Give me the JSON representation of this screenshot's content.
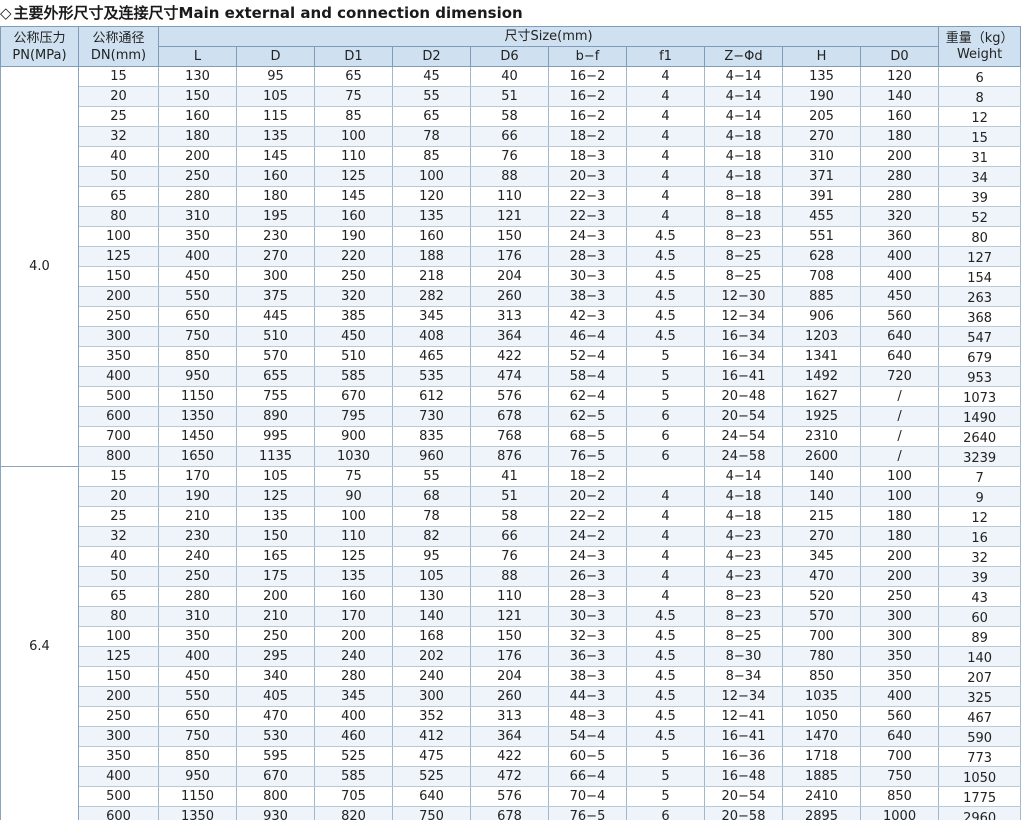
{
  "heading": {
    "diamond": "◇",
    "text": "主要外形尺寸及连接尺寸Main external and connection dimension"
  },
  "header": {
    "pn_cn": "公称压力",
    "pn_en": "PN(MPa)",
    "dn_cn": "公称通径",
    "dn_en": "DN(mm)",
    "size": "尺寸Size(mm)",
    "weight_cn": "重量（kg）",
    "weight_en": "Weight",
    "cols": [
      "L",
      "D",
      "D1",
      "D2",
      "D6",
      "b−f",
      "f1",
      "Z−Φd",
      "H",
      "D0"
    ]
  },
  "groups": [
    {
      "pn": "4.0",
      "rows": [
        [
          "15",
          "130",
          "95",
          "65",
          "45",
          "40",
          "16−2",
          "4",
          "4−14",
          "135",
          "120",
          "6"
        ],
        [
          "20",
          "150",
          "105",
          "75",
          "55",
          "51",
          "16−2",
          "4",
          "4−14",
          "190",
          "140",
          "8"
        ],
        [
          "25",
          "160",
          "115",
          "85",
          "65",
          "58",
          "16−2",
          "4",
          "4−14",
          "205",
          "160",
          "12"
        ],
        [
          "32",
          "180",
          "135",
          "100",
          "78",
          "66",
          "18−2",
          "4",
          "4−18",
          "270",
          "180",
          "15"
        ],
        [
          "40",
          "200",
          "145",
          "110",
          "85",
          "76",
          "18−3",
          "4",
          "4−18",
          "310",
          "200",
          "31"
        ],
        [
          "50",
          "250",
          "160",
          "125",
          "100",
          "88",
          "20−3",
          "4",
          "4−18",
          "371",
          "280",
          "34"
        ],
        [
          "65",
          "280",
          "180",
          "145",
          "120",
          "110",
          "22−3",
          "4",
          "8−18",
          "391",
          "280",
          "39"
        ],
        [
          "80",
          "310",
          "195",
          "160",
          "135",
          "121",
          "22−3",
          "4",
          "8−18",
          "455",
          "320",
          "52"
        ],
        [
          "100",
          "350",
          "230",
          "190",
          "160",
          "150",
          "24−3",
          "4.5",
          "8−23",
          "551",
          "360",
          "80"
        ],
        [
          "125",
          "400",
          "270",
          "220",
          "188",
          "176",
          "28−3",
          "4.5",
          "8−25",
          "628",
          "400",
          "127"
        ],
        [
          "150",
          "450",
          "300",
          "250",
          "218",
          "204",
          "30−3",
          "4.5",
          "8−25",
          "708",
          "400",
          "154"
        ],
        [
          "200",
          "550",
          "375",
          "320",
          "282",
          "260",
          "38−3",
          "4.5",
          "12−30",
          "885",
          "450",
          "263"
        ],
        [
          "250",
          "650",
          "445",
          "385",
          "345",
          "313",
          "42−3",
          "4.5",
          "12−34",
          "906",
          "560",
          "368"
        ],
        [
          "300",
          "750",
          "510",
          "450",
          "408",
          "364",
          "46−4",
          "4.5",
          "16−34",
          "1203",
          "640",
          "547"
        ],
        [
          "350",
          "850",
          "570",
          "510",
          "465",
          "422",
          "52−4",
          "5",
          "16−34",
          "1341",
          "640",
          "679"
        ],
        [
          "400",
          "950",
          "655",
          "585",
          "535",
          "474",
          "58−4",
          "5",
          "16−41",
          "1492",
          "720",
          "953"
        ],
        [
          "500",
          "1150",
          "755",
          "670",
          "612",
          "576",
          "62−4",
          "5",
          "20−48",
          "1627",
          "/",
          "1073"
        ],
        [
          "600",
          "1350",
          "890",
          "795",
          "730",
          "678",
          "62−5",
          "6",
          "20−54",
          "1925",
          "/",
          "1490"
        ],
        [
          "700",
          "1450",
          "995",
          "900",
          "835",
          "768",
          "68−5",
          "6",
          "24−54",
          "2310",
          "/",
          "2640"
        ],
        [
          "800",
          "1650",
          "1135",
          "1030",
          "960",
          "876",
          "76−5",
          "6",
          "24−58",
          "2600",
          "/",
          "3239"
        ]
      ]
    },
    {
      "pn": "6.4",
      "rows": [
        [
          "15",
          "170",
          "105",
          "75",
          "55",
          "41",
          "18−2",
          "",
          "4−14",
          "140",
          "100",
          "7"
        ],
        [
          "20",
          "190",
          "125",
          "90",
          "68",
          "51",
          "20−2",
          "4",
          "4−18",
          "140",
          "100",
          "9"
        ],
        [
          "25",
          "210",
          "135",
          "100",
          "78",
          "58",
          "22−2",
          "4",
          "4−18",
          "215",
          "180",
          "12"
        ],
        [
          "32",
          "230",
          "150",
          "110",
          "82",
          "66",
          "24−2",
          "4",
          "4−23",
          "270",
          "180",
          "16"
        ],
        [
          "40",
          "240",
          "165",
          "125",
          "95",
          "76",
          "24−3",
          "4",
          "4−23",
          "345",
          "200",
          "32"
        ],
        [
          "50",
          "250",
          "175",
          "135",
          "105",
          "88",
          "26−3",
          "4",
          "4−23",
          "470",
          "200",
          "39"
        ],
        [
          "65",
          "280",
          "200",
          "160",
          "130",
          "110",
          "28−3",
          "4",
          "8−23",
          "520",
          "250",
          "43"
        ],
        [
          "80",
          "310",
          "210",
          "170",
          "140",
          "121",
          "30−3",
          "4.5",
          "8−23",
          "570",
          "300",
          "60"
        ],
        [
          "100",
          "350",
          "250",
          "200",
          "168",
          "150",
          "32−3",
          "4.5",
          "8−25",
          "700",
          "300",
          "89"
        ],
        [
          "125",
          "400",
          "295",
          "240",
          "202",
          "176",
          "36−3",
          "4.5",
          "8−30",
          "780",
          "350",
          "140"
        ],
        [
          "150",
          "450",
          "340",
          "280",
          "240",
          "204",
          "38−3",
          "4.5",
          "8−34",
          "850",
          "350",
          "207"
        ],
        [
          "200",
          "550",
          "405",
          "345",
          "300",
          "260",
          "44−3",
          "4.5",
          "12−34",
          "1035",
          "400",
          "325"
        ],
        [
          "250",
          "650",
          "470",
          "400",
          "352",
          "313",
          "48−3",
          "4.5",
          "12−41",
          "1050",
          "560",
          "467"
        ],
        [
          "300",
          "750",
          "530",
          "460",
          "412",
          "364",
          "54−4",
          "4.5",
          "16−41",
          "1470",
          "640",
          "590"
        ],
        [
          "350",
          "850",
          "595",
          "525",
          "475",
          "422",
          "60−5",
          "5",
          "16−36",
          "1718",
          "700",
          "773"
        ],
        [
          "400",
          "950",
          "670",
          "585",
          "525",
          "472",
          "66−4",
          "5",
          "16−48",
          "1885",
          "750",
          "1050"
        ],
        [
          "500",
          "1150",
          "800",
          "705",
          "640",
          "576",
          "70−4",
          "5",
          "20−54",
          "2410",
          "850",
          "1775"
        ],
        [
          "600",
          "1350",
          "930",
          "820",
          "750",
          "678",
          "76−5",
          "6",
          "20−58",
          "2895",
          "1000",
          "2960"
        ]
      ]
    }
  ]
}
